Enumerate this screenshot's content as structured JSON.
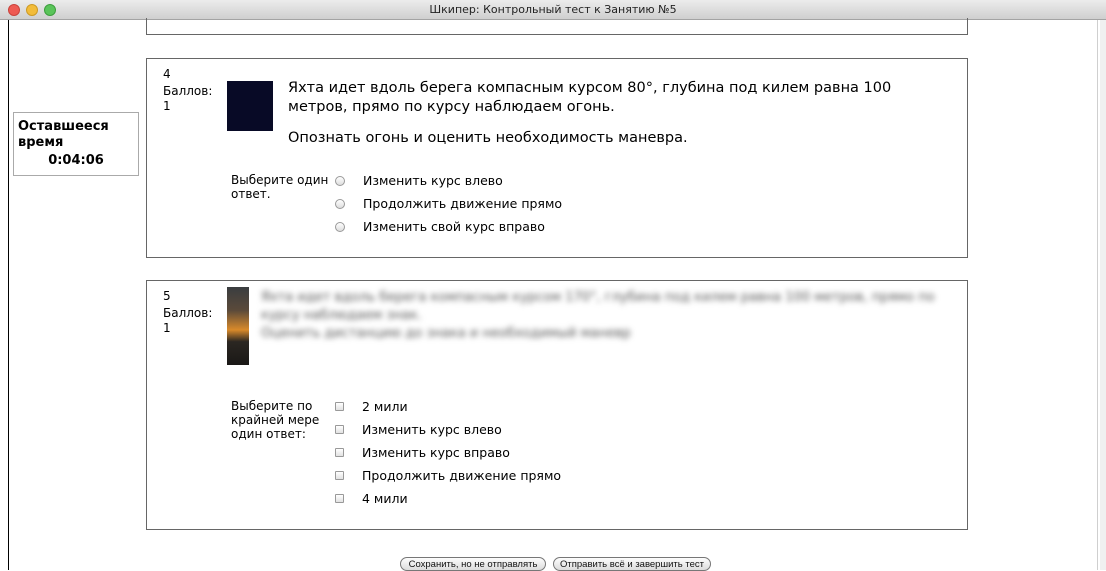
{
  "window": {
    "title": "Шкипер: Контрольный тест к Занятию №5"
  },
  "timer": {
    "label": "Оставшееся время",
    "value": "0:04:06"
  },
  "questions": [
    {
      "number": "4",
      "points_label": "Баллов:",
      "points_value": "1",
      "text1": "Яхта идет вдоль берега компасным курсом 80°, глубина под килем равна 100 метров, прямо по курсу наблюдаем огонь.",
      "text2": "Опознать огонь и оценить необходимость маневра.",
      "answer_prompt": "Выберите один ответ.",
      "options": [
        "Изменить курс влево",
        "Продолжить движение прямо",
        "Изменить свой курс вправо"
      ]
    },
    {
      "number": "5",
      "points_label": "Баллов:",
      "points_value": "1",
      "text1": "Яхта идет вдоль берега компасным курсом 170°, глубина под килем равна 100 метров, прямо по курсу наблюдаем знак.",
      "text2": "Оценить дистанцию до знака и необходимый маневр",
      "answer_prompt": "Выберите по крайней мере один ответ:",
      "options": [
        "2 мили",
        "Изменить курс влево",
        "Изменить курс вправо",
        "Продолжить движение прямо",
        "4 мили"
      ]
    }
  ],
  "buttons": {
    "save": "Сохранить, но не отправлять",
    "submit": "Отправить всё и завершить тест"
  }
}
